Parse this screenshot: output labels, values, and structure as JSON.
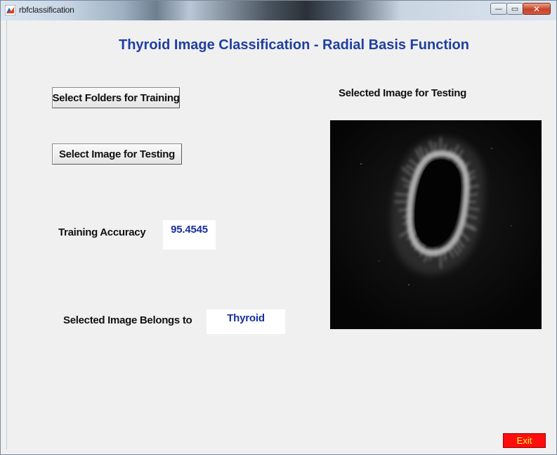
{
  "window": {
    "title": "rbfclassification",
    "controls": {
      "minimize": "—",
      "maximize": "▭",
      "close": "✕"
    }
  },
  "main": {
    "title": "Thyroid Image Classification - Radial Basis Function",
    "buttons": {
      "select_folders": "Select Folders for Training",
      "select_image": "Select Image for Testing",
      "exit": "Exit"
    },
    "labels": {
      "training_accuracy": "Training Accuracy",
      "belongs_to": "Selected Image Belongs to",
      "selected_image": "Selected Image for Testing"
    },
    "values": {
      "training_accuracy": "95.4545",
      "classification": "Thyroid"
    }
  },
  "colors": {
    "title": "#1f3fa0",
    "value_text": "#1a2fa0",
    "exit_bg": "#ff0d0d",
    "exit_text": "#ffff33"
  }
}
